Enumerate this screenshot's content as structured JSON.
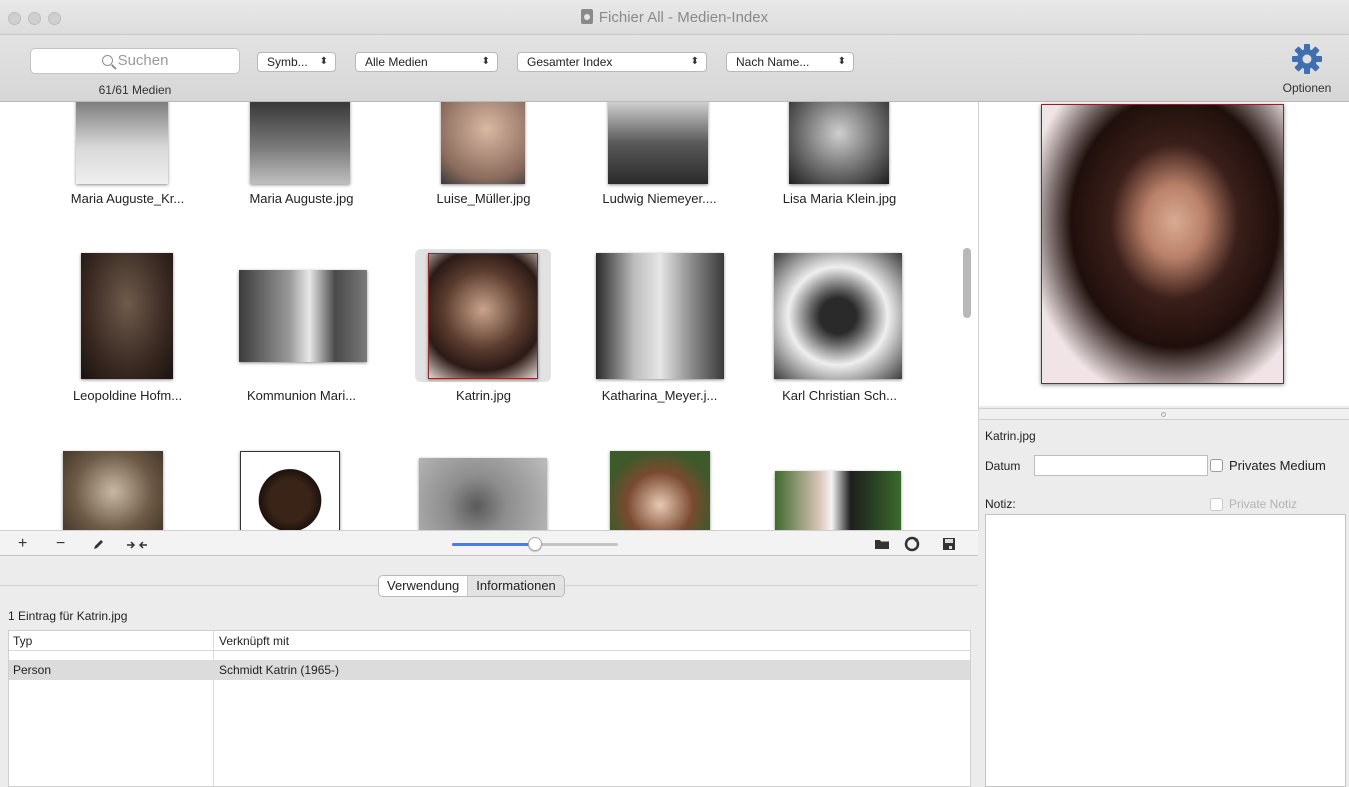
{
  "window": {
    "title": "Fichier All - Medien-Index"
  },
  "toolbar": {
    "search_placeholder": "Suchen",
    "count_label": "61/61 Medien",
    "view_popup": "Symb...",
    "media_popup": "Alle Medien",
    "index_popup": "Gesamter Index",
    "sort_popup": "Nach Name...",
    "options_label": "Optionen",
    "options_icon": "gear-icon"
  },
  "grid": {
    "rows": [
      [
        "Maria Auguste_Kr...",
        "Maria Auguste.jpg",
        "Luise_Müller.jpg",
        "Ludwig Niemeyer....",
        "Lisa Maria Klein.jpg"
      ],
      [
        "Leopoldine Hofm...",
        "Kommunion Mari...",
        "Katrin.jpg",
        "Katharina_Meyer.j...",
        "Karl Christian Sch..."
      ]
    ],
    "selected": "Katrin.jpg",
    "zoom_level": 0.5
  },
  "gridbar": {
    "add": "+",
    "remove": "−",
    "edit_icon": "pencil-icon",
    "merge_icon": "merge-arrows-icon",
    "folder_icon": "folder-icon",
    "refresh_icon": "refresh-icon",
    "save_icon": "save-icon"
  },
  "lower": {
    "tabs": [
      "Verwendung",
      "Informationen"
    ],
    "active_tab": "Informationen",
    "entry_label": "1 Eintrag für Katrin.jpg",
    "columns": [
      "Typ",
      "Verknüpft mit"
    ],
    "rows": [
      {
        "typ": "Person",
        "link": "Schmidt Katrin (1965-)"
      }
    ]
  },
  "details": {
    "filename": "Katrin.jpg",
    "date_label": "Datum",
    "date_value": "",
    "private_media_label": "Privates Medium",
    "note_label": "Notiz:",
    "private_note_label": "Private Notiz",
    "note_value": ""
  }
}
